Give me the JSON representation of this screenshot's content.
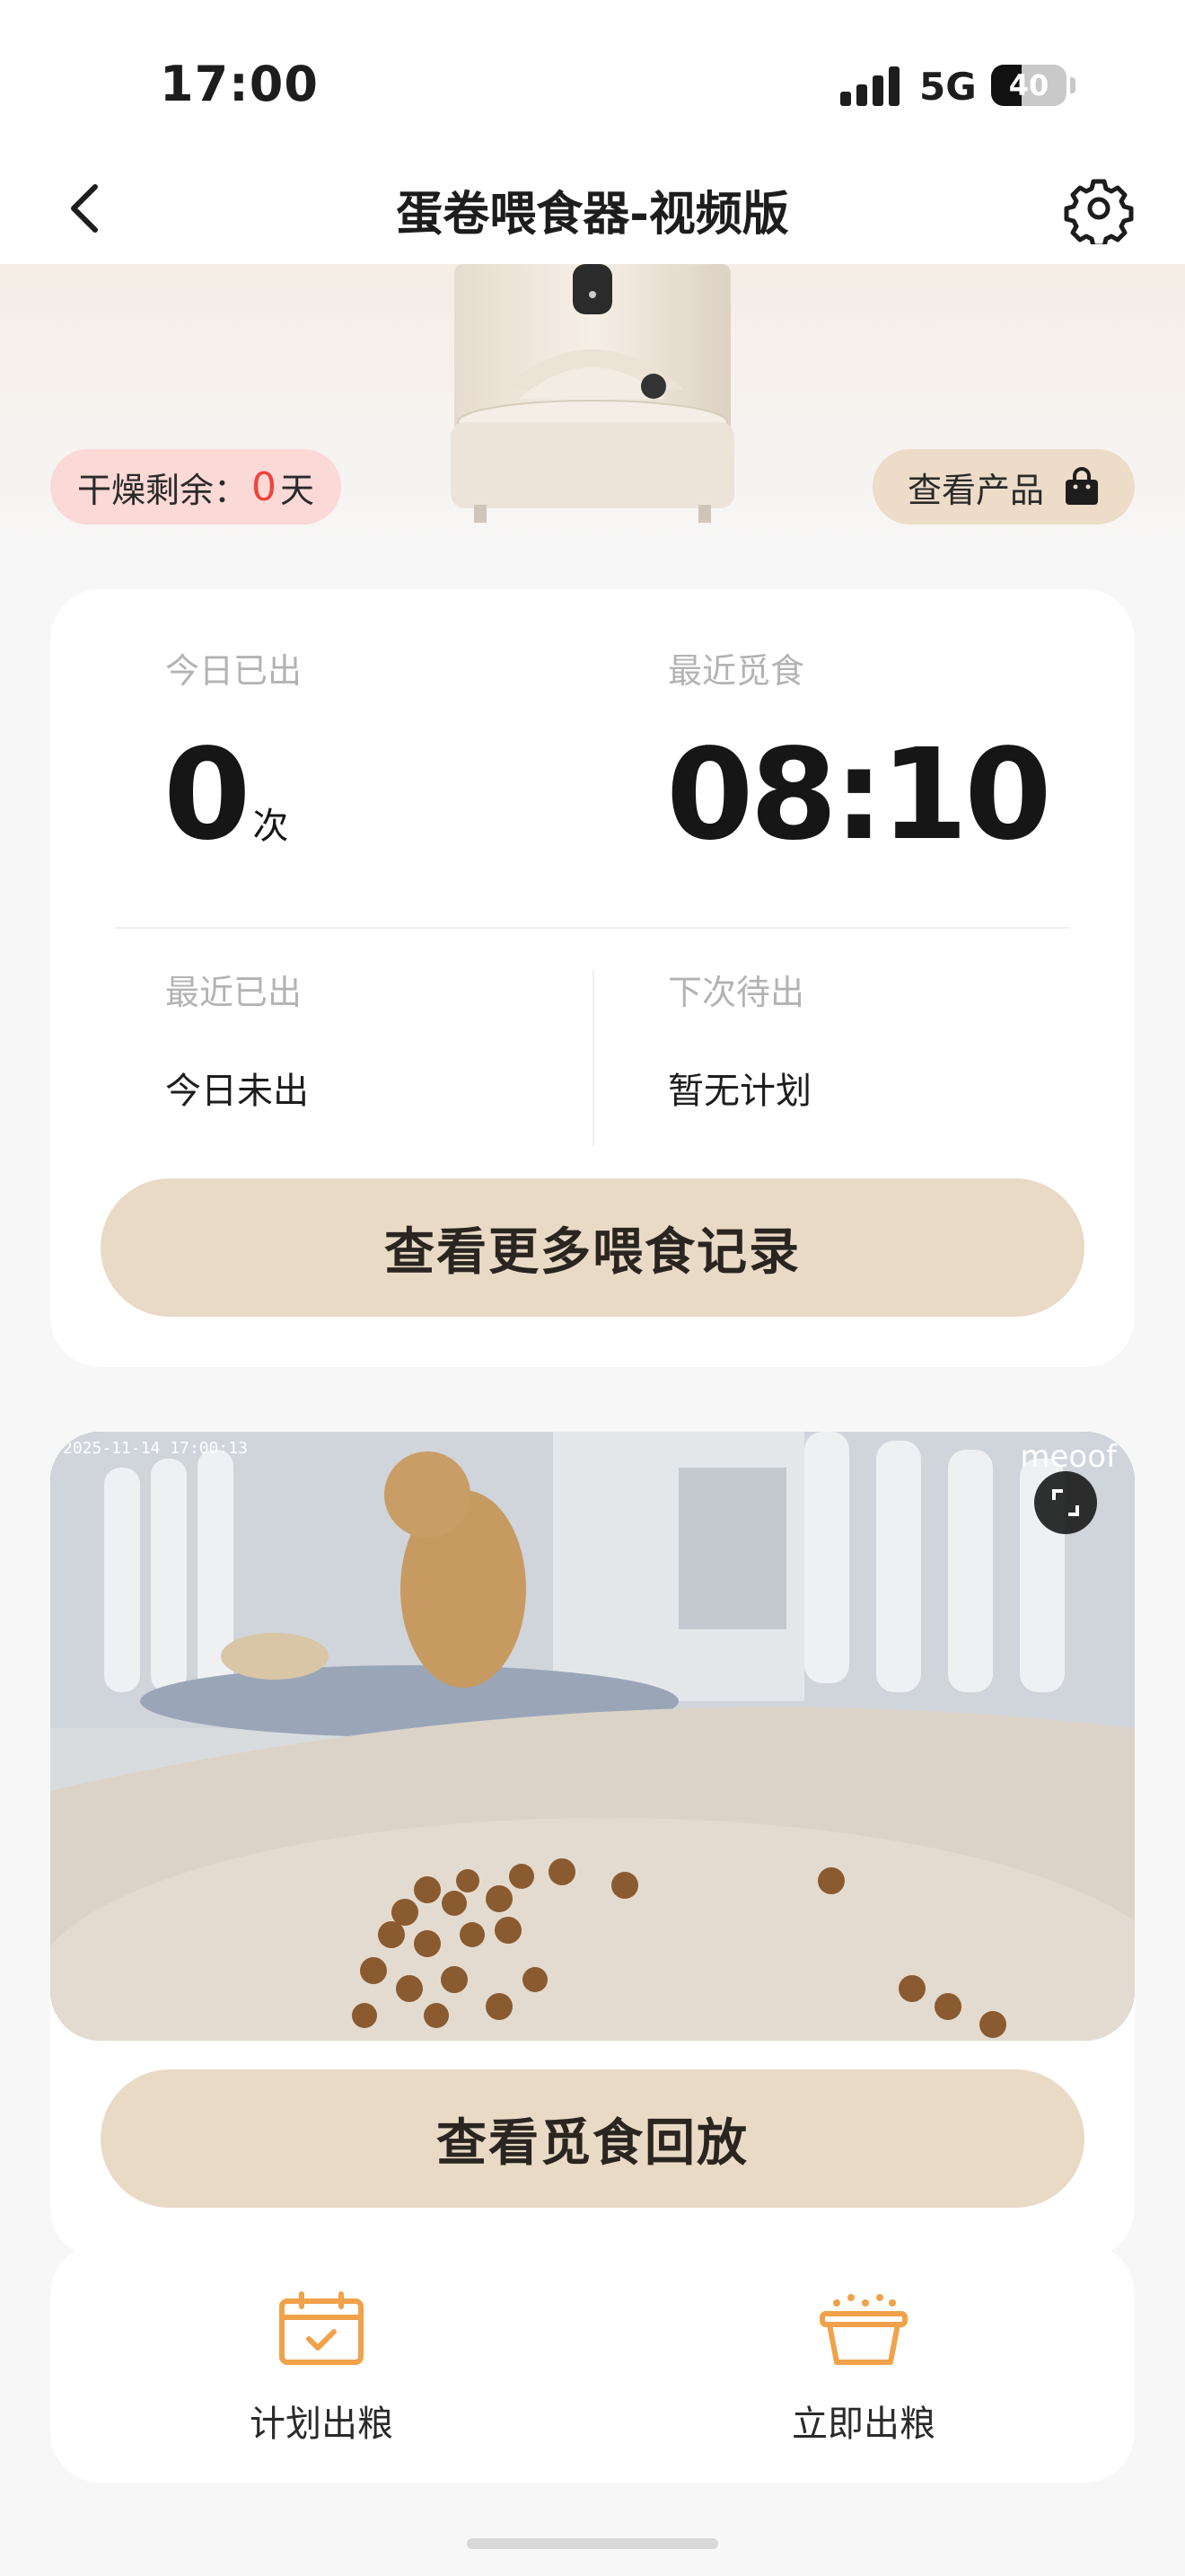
{
  "status_bar": {
    "time": "17:00",
    "network": "5G",
    "battery": "40",
    "battery_level": 0.4
  },
  "header": {
    "title": "蛋卷喂食器-视频版",
    "back_icon": "chevron-left-icon",
    "settings_icon": "gear-icon"
  },
  "hero": {
    "dry_label": "干燥剩余：",
    "dry_value": "0",
    "dry_unit": "天",
    "product_button": "查看产品",
    "product_icon": "shopping-bag-icon"
  },
  "stats": {
    "today_label": "今日已出",
    "today_value": "0",
    "today_unit": "次",
    "last_forage_label": "最近觅食",
    "last_forage_value": "08:10",
    "last_out_label": "最近已出",
    "last_out_value": "今日未出",
    "next_label": "下次待出",
    "next_value": "暂无计划",
    "records_button": "查看更多喂食记录"
  },
  "video": {
    "timestamp": "2025-11-14 17:00:13",
    "brand": "meoof",
    "fullscreen_icon": "fullscreen-icon",
    "replay_button": "查看觅食回放"
  },
  "actions": {
    "plan": {
      "label": "计划出粮",
      "icon": "calendar-check-icon"
    },
    "now": {
      "label": "立即出粮",
      "icon": "food-bowl-icon"
    }
  },
  "colors": {
    "accent": "#f0a24a",
    "button_bg": "#e9dac6",
    "warning_red": "#f0443b",
    "warning_bg": "#fbd9d6"
  }
}
